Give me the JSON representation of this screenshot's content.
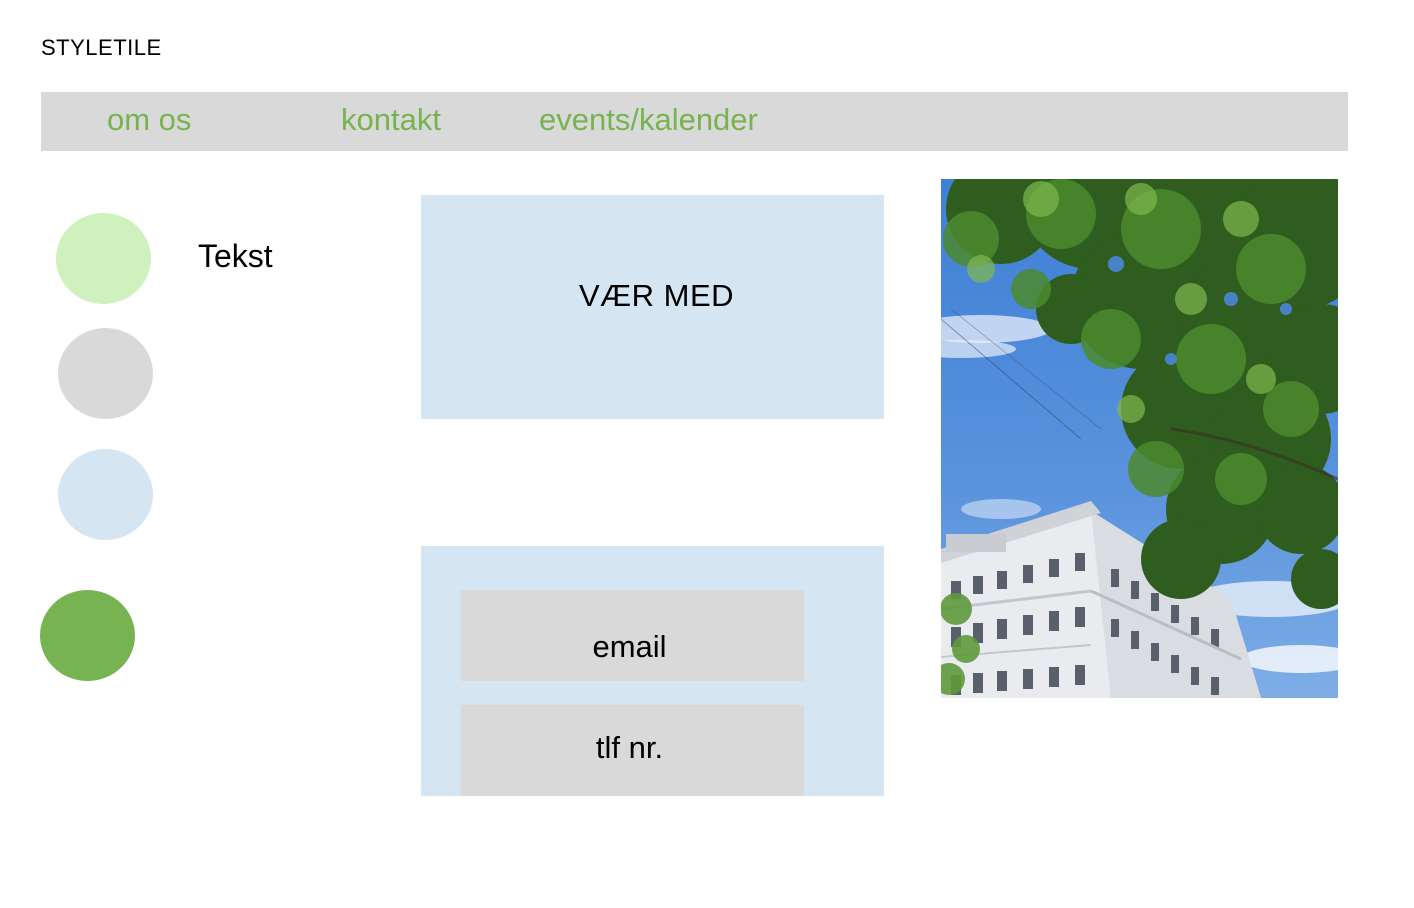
{
  "page": {
    "title": "STYLETILE"
  },
  "nav": {
    "items": [
      {
        "label": "om os"
      },
      {
        "label": "kontakt"
      },
      {
        "label": "events/kalender"
      }
    ]
  },
  "palette": {
    "swatches": [
      "#cff1bd",
      "#d9d9d9",
      "#d6e5f2",
      "#77b350"
    ]
  },
  "typography": {
    "sample": "Tekst"
  },
  "cta": {
    "label": "VÆR MED"
  },
  "form": {
    "email_label": "email",
    "phone_label": "tlf nr."
  },
  "photo": {
    "subject": "tree-and-building-photo"
  },
  "colors": {
    "accent_green": "#77b350",
    "light_green": "#cff1bd",
    "neutral_grey": "#d9d9d9",
    "light_blue": "#d6e5f2"
  }
}
